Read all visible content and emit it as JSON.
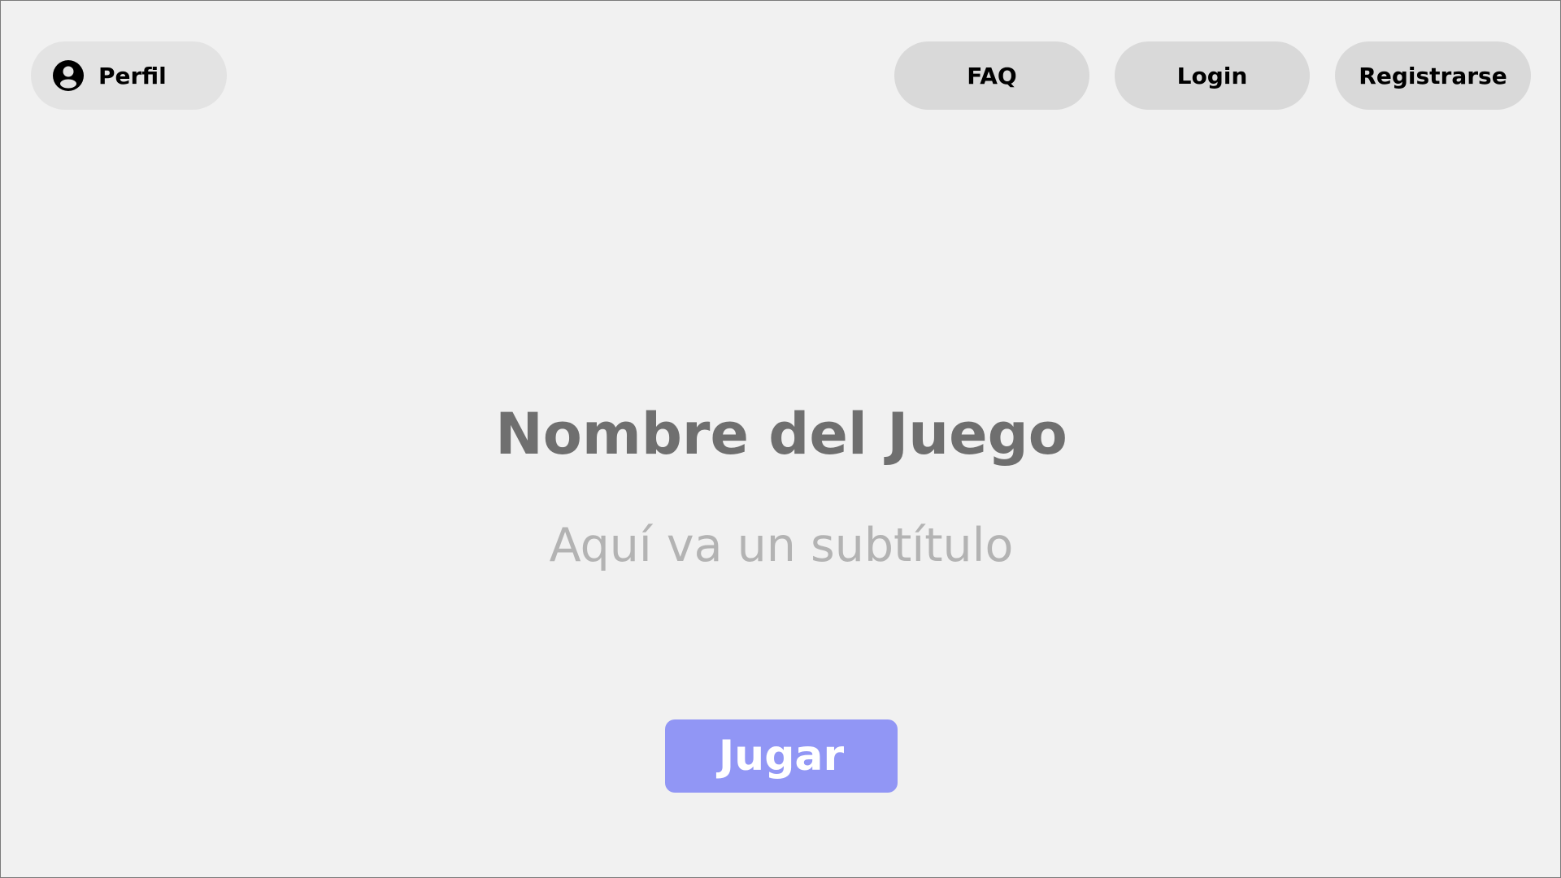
{
  "header": {
    "profile": {
      "label": "Perfil",
      "icon": "user-circle-icon"
    },
    "nav": {
      "faq": "FAQ",
      "login": "Login",
      "register": "Registrarse"
    }
  },
  "main": {
    "title": "Nombre del Juego",
    "subtitle": "Aquí va un subtítulo",
    "play_label": "Jugar"
  },
  "colors": {
    "background": "#f1f1f1",
    "pill": "#d9d9d9",
    "title": "#6f6f6f",
    "subtitle": "#b3b3b3",
    "accent": "#9196f5"
  }
}
